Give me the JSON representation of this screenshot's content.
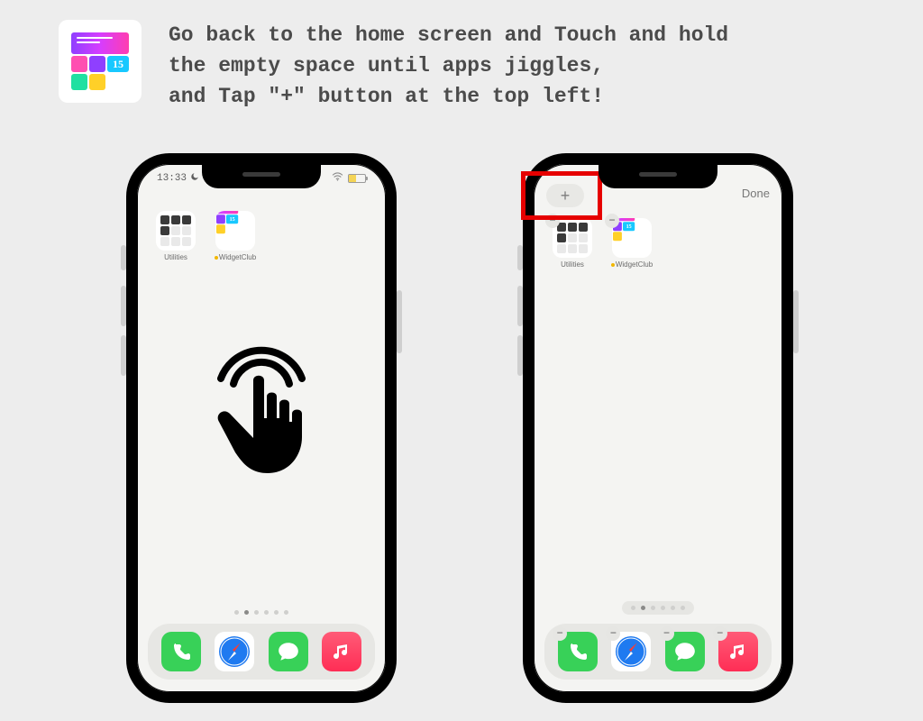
{
  "instructions": {
    "line1": "Go back to the home screen and Touch and hold",
    "line2": "the empty space until apps jiggles,",
    "line3": "and Tap \"+\" button at the top left!"
  },
  "phone_left": {
    "status": {
      "time": "13:33"
    },
    "apps": [
      {
        "label": "Utilities"
      },
      {
        "label": "WidgetClub",
        "has_dot": true
      }
    ]
  },
  "phone_right": {
    "controls": {
      "plus_label": "+",
      "done_label": "Done"
    },
    "apps": [
      {
        "label": "Utilities"
      },
      {
        "label": "WidgetClub",
        "has_dot": true
      }
    ]
  },
  "dock_apps": [
    {
      "name": "phone",
      "color": "#38d158"
    },
    {
      "name": "safari",
      "color": "#1f7af0"
    },
    {
      "name": "messages",
      "color": "#38d158"
    },
    {
      "name": "music",
      "color": "#ff2d55"
    }
  ],
  "colors": {
    "highlight": "#e60000",
    "bg": "#ededed"
  }
}
